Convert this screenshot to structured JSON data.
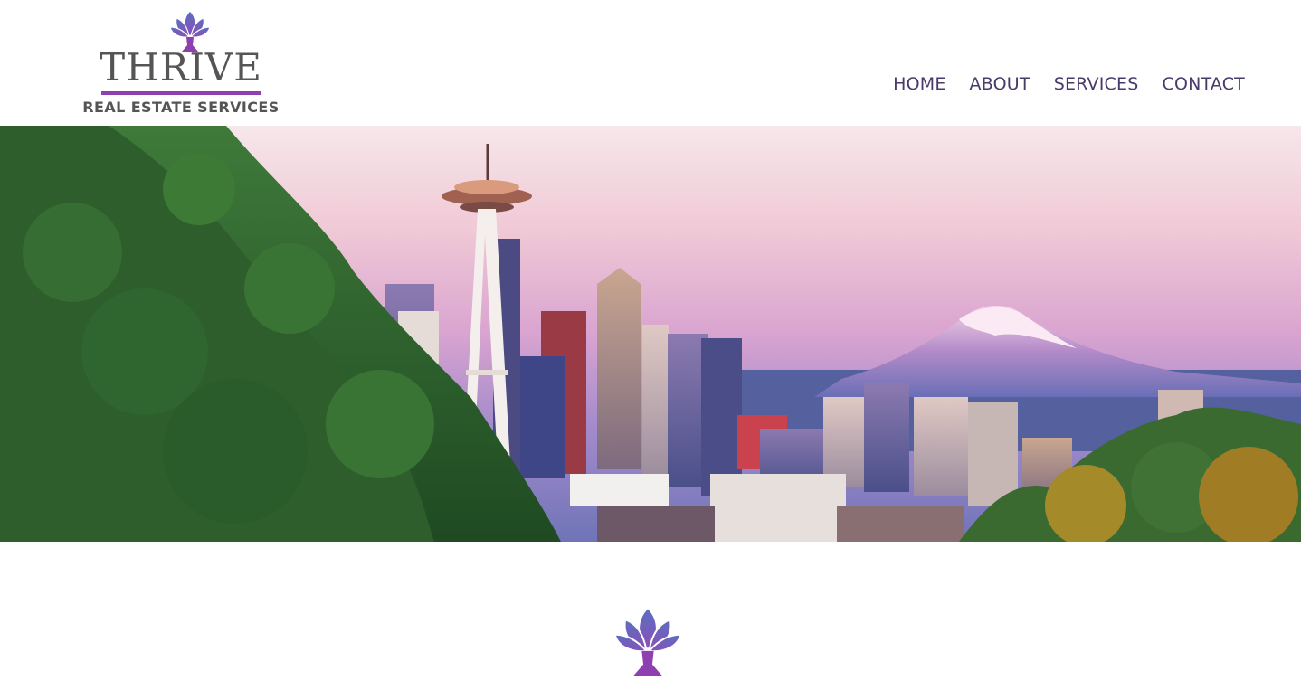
{
  "brand": {
    "wordmark": "THRIVE",
    "subtitle": "REAL ESTATE SERVICES",
    "logo_icon": "lotus-tree-icon"
  },
  "nav": {
    "items": [
      {
        "label": "HOME"
      },
      {
        "label": "ABOUT"
      },
      {
        "label": "SERVICES"
      },
      {
        "label": "CONTACT"
      }
    ]
  },
  "hero": {
    "image": "seattle-skyline-photo",
    "landmarks": [
      "space-needle",
      "mount-rainier"
    ]
  },
  "section": {
    "emblem_icon": "lotus-tree-icon"
  },
  "colors": {
    "nav_text": "#4a3a6a",
    "wordmark": "#555555",
    "accent_purple": "#8e3fb0",
    "lotus_blue": "#5a6fc0",
    "lotus_violet": "#8a4fb8"
  }
}
